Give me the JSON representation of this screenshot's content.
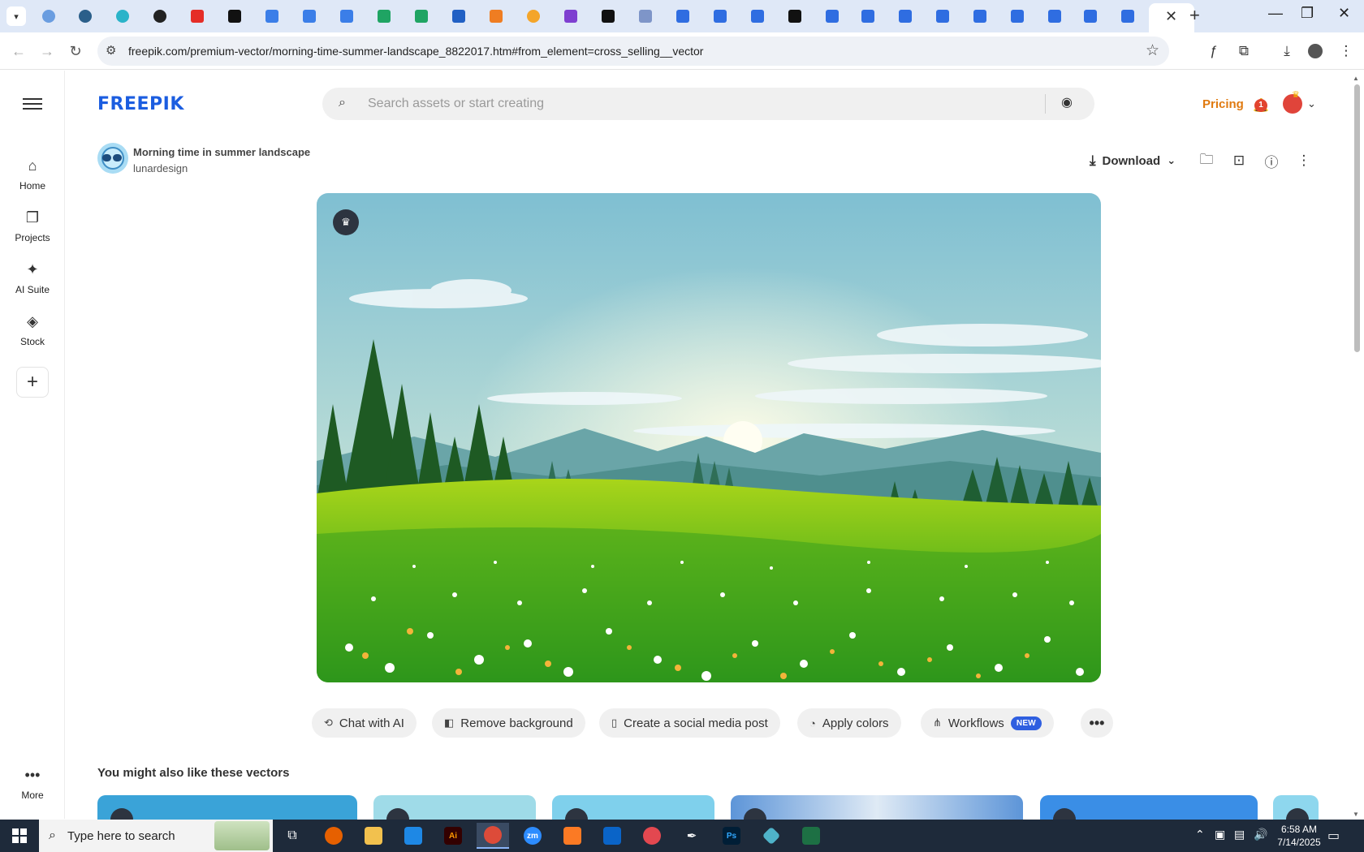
{
  "browser": {
    "url": "freepik.com/premium-vector/morning-time-summer-landscape_8822017.htm#from_element=cross_selling__vector",
    "tab_close": "✕",
    "new_tab": "+",
    "min": "—",
    "restore": "❐",
    "close": "✕"
  },
  "sidebar": {
    "items": [
      {
        "label": "Home"
      },
      {
        "label": "Projects"
      },
      {
        "label": "AI Suite"
      },
      {
        "label": "Stock"
      }
    ],
    "more_label": "More"
  },
  "header": {
    "logo": "FREEPIK",
    "search_placeholder": "Search assets or start creating",
    "pricing": "Pricing",
    "notification_count": "1"
  },
  "asset": {
    "title": "Morning time in summer landscape",
    "author": "lunardesign",
    "download_label": "Download"
  },
  "tools": {
    "chat": "Chat with AI",
    "remove_bg": "Remove background",
    "social": "Create a social media post",
    "colors": "Apply colors",
    "workflows": "Workflows",
    "new_badge": "NEW"
  },
  "related": {
    "title": "You might also like these vectors"
  },
  "taskbar": {
    "search_text": "Type here to search",
    "time": "6:58 AM",
    "date": "7/14/2025",
    "apps": [
      "Ai",
      "zm",
      "Ps"
    ]
  },
  "colors": {
    "brand": "#1b5de0",
    "pricing": "#e07a10",
    "new_badge": "#2f5fe0"
  }
}
